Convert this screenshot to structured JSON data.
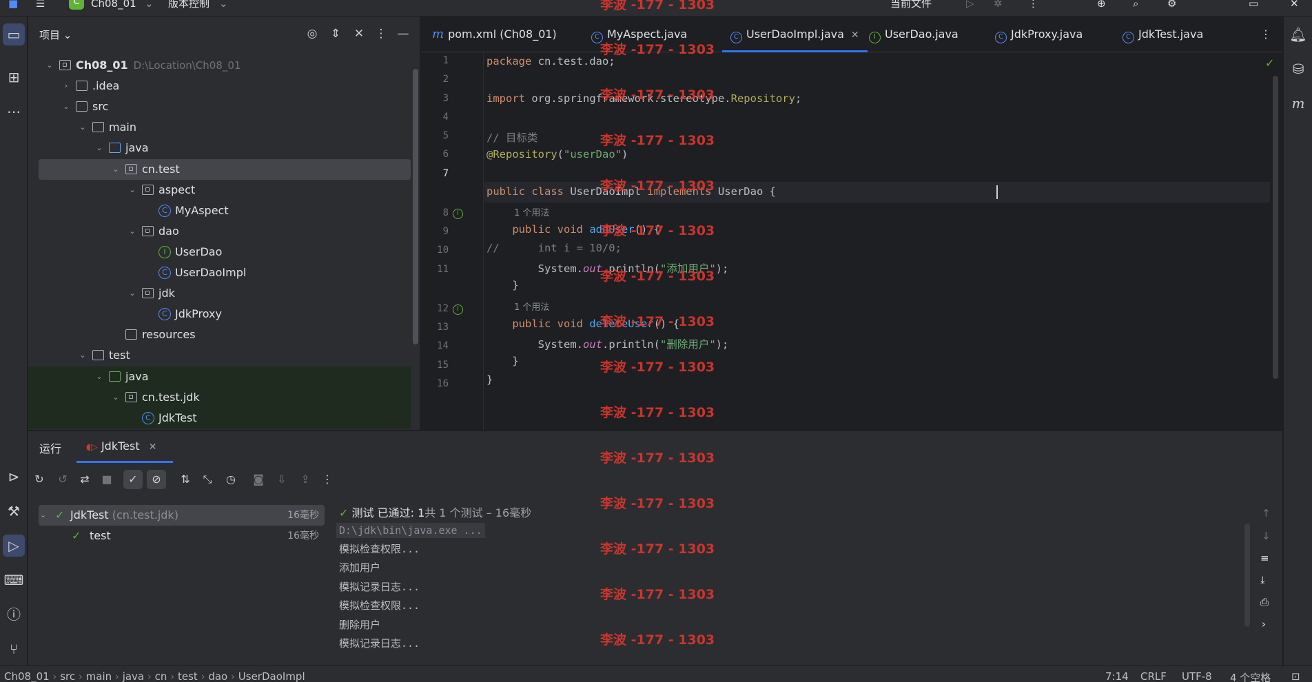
{
  "titlebar": {
    "project_badge": "C",
    "project_name": "Ch08_01",
    "vcs_label": "版本控制",
    "run_config": "当前文件",
    "icons": [
      "menu-icon",
      "run-icon",
      "debug-icon",
      "more-icon",
      "add-user-icon",
      "search-icon",
      "settings-icon",
      "minimize-icon",
      "close-icon"
    ]
  },
  "project_panel": {
    "title": "项目",
    "tree": [
      {
        "label": "Ch08_01",
        "path": "D:\\Location\\Ch08_01",
        "depth": 0,
        "expanded": true,
        "icon": "module-folder-icon"
      },
      {
        "label": ".idea",
        "depth": 1,
        "expanded": false,
        "icon": "folder-icon"
      },
      {
        "label": "src",
        "depth": 1,
        "expanded": true,
        "icon": "folder-icon"
      },
      {
        "label": "main",
        "depth": 2,
        "expanded": true,
        "icon": "folder-icon"
      },
      {
        "label": "java",
        "depth": 3,
        "expanded": true,
        "icon": "source-folder-icon"
      },
      {
        "label": "cn.test",
        "depth": 4,
        "expanded": true,
        "icon": "package-icon",
        "selected": true
      },
      {
        "label": "aspect",
        "depth": 5,
        "expanded": true,
        "icon": "package-icon"
      },
      {
        "label": "MyAspect",
        "depth": 6,
        "icon": "class-icon"
      },
      {
        "label": "dao",
        "depth": 5,
        "expanded": true,
        "icon": "package-icon"
      },
      {
        "label": "UserDao",
        "depth": 6,
        "icon": "interface-icon"
      },
      {
        "label": "UserDaoImpl",
        "depth": 6,
        "icon": "class-icon"
      },
      {
        "label": "jdk",
        "depth": 5,
        "expanded": true,
        "icon": "package-icon"
      },
      {
        "label": "JdkProxy",
        "depth": 6,
        "icon": "class-icon"
      },
      {
        "label": "resources",
        "depth": 4,
        "icon": "resources-folder-icon"
      },
      {
        "label": "test",
        "depth": 2,
        "expanded": true,
        "icon": "folder-icon"
      },
      {
        "label": "java",
        "depth": 3,
        "expanded": true,
        "icon": "test-folder-icon",
        "test": true
      },
      {
        "label": "cn.test.jdk",
        "depth": 4,
        "expanded": true,
        "icon": "package-icon",
        "test": true
      },
      {
        "label": "JdkTest",
        "depth": 5,
        "icon": "class-icon",
        "test": true
      }
    ]
  },
  "editor": {
    "tabs": [
      {
        "label": "pom.xml (Ch08_01)",
        "icon": "maven-icon"
      },
      {
        "label": "MyAspect.java",
        "icon": "class-icon"
      },
      {
        "label": "UserDaoImpl.java",
        "icon": "class-icon",
        "active": true
      },
      {
        "label": "UserDao.java",
        "icon": "interface-icon"
      },
      {
        "label": "JdkProxy.java",
        "icon": "class-icon"
      },
      {
        "label": "JdkTest.java",
        "icon": "class-icon"
      }
    ],
    "line_numbers": [
      "1",
      "2",
      "3",
      "4",
      "5",
      "6",
      "7",
      "8",
      "9",
      "10",
      "11",
      "12",
      "13",
      "14",
      "15",
      "16"
    ],
    "current_line": "7",
    "code": {
      "l1_kw": "package",
      "l1_rest": " cn.test.dao;",
      "l3_kw": "import",
      "l3_pkg": " org.springframework.stereotype.",
      "l3_ann": "Repository",
      "l3_end": ";",
      "l5": "// 目标类",
      "l6_ann": "@Repository",
      "l6_open": "(",
      "l6_str": "\"userDao\"",
      "l6_close": ")",
      "l7_kw1": "public",
      "l7_kw2": " class ",
      "l7_name": "UserDaoImpl",
      "l7_kw3": " implements ",
      "l7_iface": "UserDao",
      "l7_end": " {",
      "hint1": "1 个用法",
      "l8_kw": "    public void ",
      "l8_fn": "addUser",
      "l8_end": "() {",
      "l9": "//      int i = 10/0;",
      "l10_a": "        System.",
      "l10_out": "out",
      "l10_b": ".println(",
      "l10_str": "\"添加用户\"",
      "l10_c": ");",
      "l11": "    }",
      "hint2": "1 个用法",
      "l12_kw": "    public void ",
      "l12_fn": "deleteUser",
      "l12_end": "() {",
      "l13_a": "        System.",
      "l13_out": "out",
      "l13_b": ".println(",
      "l13_str": "\"删除用户\"",
      "l13_c": ");",
      "l14": "    }",
      "l15": "}"
    }
  },
  "run_panel": {
    "title": "运行",
    "tab_label": "JdkTest",
    "test_tree": [
      {
        "label": "JdkTest",
        "sub": "(cn.test.jdk)",
        "duration": "16毫秒"
      },
      {
        "label": "test",
        "duration": "16毫秒"
      }
    ],
    "summary_prefix": "测试 已通过: ",
    "summary_count": "1",
    "summary_suffix": "共 1 个测试 – 16毫秒",
    "console_lines": [
      "D:\\jdk\\bin\\java.exe ...",
      "模拟检查权限...",
      "添加用户",
      "模拟记录日志...",
      "模拟检查权限...",
      "删除用户",
      "模拟记录日志..."
    ]
  },
  "statusbar": {
    "breadcrumb": [
      "Ch08_01",
      "src",
      "main",
      "java",
      "cn",
      "test",
      "dao",
      "UserDaoImpl"
    ],
    "position": "7:14",
    "line_sep": "CRLF",
    "encoding": "UTF-8",
    "indent": "4 个空格"
  },
  "watermark": "李波 -177 - 1303",
  "colors": {
    "accent": "#3574f0",
    "success": "#5fb336",
    "watermark": "#d9382f"
  }
}
